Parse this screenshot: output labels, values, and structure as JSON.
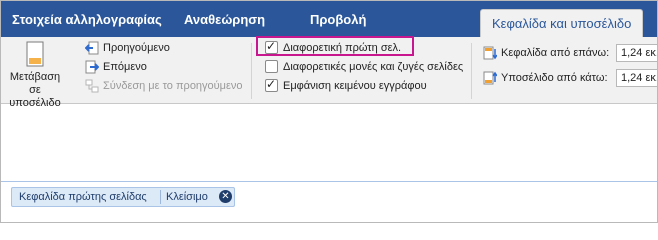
{
  "tabs": [
    {
      "label": "Στοιχεία αλληλογραφίας"
    },
    {
      "label": "Αναθεώρηση"
    },
    {
      "label": "Προβολή"
    },
    {
      "label": "Κεφαλίδα και υποσέλιδο"
    }
  ],
  "navigation": {
    "goto_footer": "Μετάβαση σε υποσέλιδο",
    "previous": "Προηγούμενο",
    "next": "Επόμενο",
    "link_previous": "Σύνδεση με το προηγούμενο"
  },
  "options": [
    {
      "label": "Διαφορετική πρώτη σελ.",
      "checked": true
    },
    {
      "label": "Διαφορετικές μονές και ζυγές σελίδες",
      "checked": false
    },
    {
      "label": "Εμφάνιση κειμένου εγγράφου",
      "checked": true
    }
  ],
  "position": {
    "header_label": "Κεφαλίδα από επάνω:",
    "header_value": "1,24 εκ.",
    "footer_label": "Υποσέλιδο από κάτω:",
    "footer_value": "1,24 εκ."
  },
  "document": {
    "section_tag": "Κεφαλίδα πρώτης σελίδας",
    "close_label": "Κλείσιμο"
  },
  "colors": {
    "ribbon_tabs": "#2b579a",
    "highlight_box": "#c8178e",
    "arrow_icon": "#2e6bd1",
    "position_icon": "#f0a030"
  }
}
